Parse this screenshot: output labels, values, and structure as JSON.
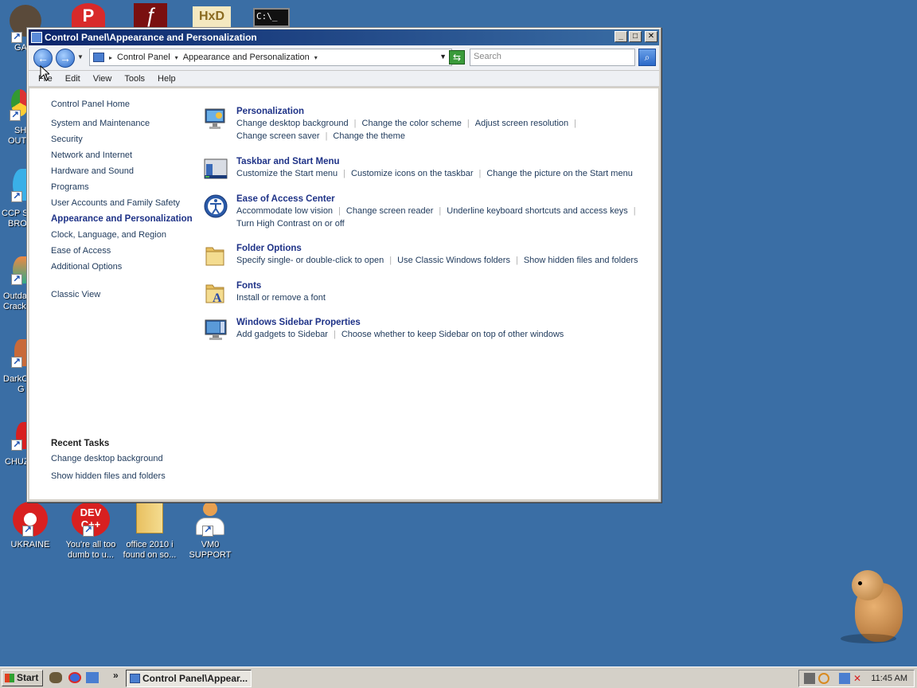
{
  "desktop": {
    "top_left_icon_label": "GA",
    "edge_labels": [
      "SH",
      "OUT",
      "CCP SI",
      "BRO",
      "Outda",
      "Crack",
      "DarkC",
      "G",
      "CHUZ"
    ],
    "bottom_icons": [
      {
        "label": "UKRAINE",
        "icon": "radiation-icon"
      },
      {
        "label": "You're all too dumb to u...",
        "icon": "dev-cpp-icon",
        "badge": "DEV C++"
      },
      {
        "label": "office 2010 i found on so...",
        "icon": "folder-icon"
      },
      {
        "label": "VM0 SUPPORT",
        "icon": "support-person-icon"
      }
    ]
  },
  "window": {
    "title": "Control Panel\\Appearance and Personalization",
    "address": {
      "crumbs": [
        "Control Panel",
        "Appearance and Personalization"
      ],
      "search_placeholder": "Search"
    },
    "menu": [
      "File",
      "Edit",
      "View",
      "Tools",
      "Help"
    ],
    "sidebar": {
      "home": "Control Panel Home",
      "items": [
        "System and Maintenance",
        "Security",
        "Network and Internet",
        "Hardware and Sound",
        "Programs",
        "User Accounts and Family Safety",
        "Appearance and Personalization",
        "Clock, Language, and Region",
        "Ease of Access",
        "Additional Options"
      ],
      "classic": "Classic View",
      "recent_title": "Recent Tasks",
      "recent": [
        "Change desktop background",
        "Show hidden files and folders"
      ]
    },
    "categories": [
      {
        "title": "Personalization",
        "icon": "monitor-paint-icon",
        "links": [
          "Change desktop background",
          "Change the color scheme",
          "Adjust screen resolution",
          "Change screen saver",
          "Change the theme"
        ]
      },
      {
        "title": "Taskbar and Start Menu",
        "icon": "taskbar-icon",
        "links": [
          "Customize the Start menu",
          "Customize icons on the taskbar",
          "Change the picture on the Start menu"
        ]
      },
      {
        "title": "Ease of Access Center",
        "icon": "ease-of-access-icon",
        "links": [
          "Accommodate low vision",
          "Change screen reader",
          "Underline keyboard shortcuts and access keys",
          "Turn High Contrast on or off"
        ]
      },
      {
        "title": "Folder Options",
        "icon": "folder-options-icon",
        "links": [
          "Specify single- or double-click to open",
          "Use Classic Windows folders",
          "Show hidden files and folders"
        ]
      },
      {
        "title": "Fonts",
        "icon": "fonts-folder-icon",
        "links": [
          "Install or remove a font"
        ]
      },
      {
        "title": "Windows Sidebar Properties",
        "icon": "sidebar-monitor-icon",
        "links": [
          "Add gadgets to Sidebar",
          "Choose whether to keep Sidebar on top of other windows"
        ]
      }
    ]
  },
  "taskbar": {
    "start": "Start",
    "overflow": "»",
    "active_task": "Control Panel\\Appear...",
    "clock": "11:45 AM"
  },
  "colors": {
    "desktop": "#3a6ea5",
    "link": "#1e395b",
    "heading": "#1e3287"
  }
}
